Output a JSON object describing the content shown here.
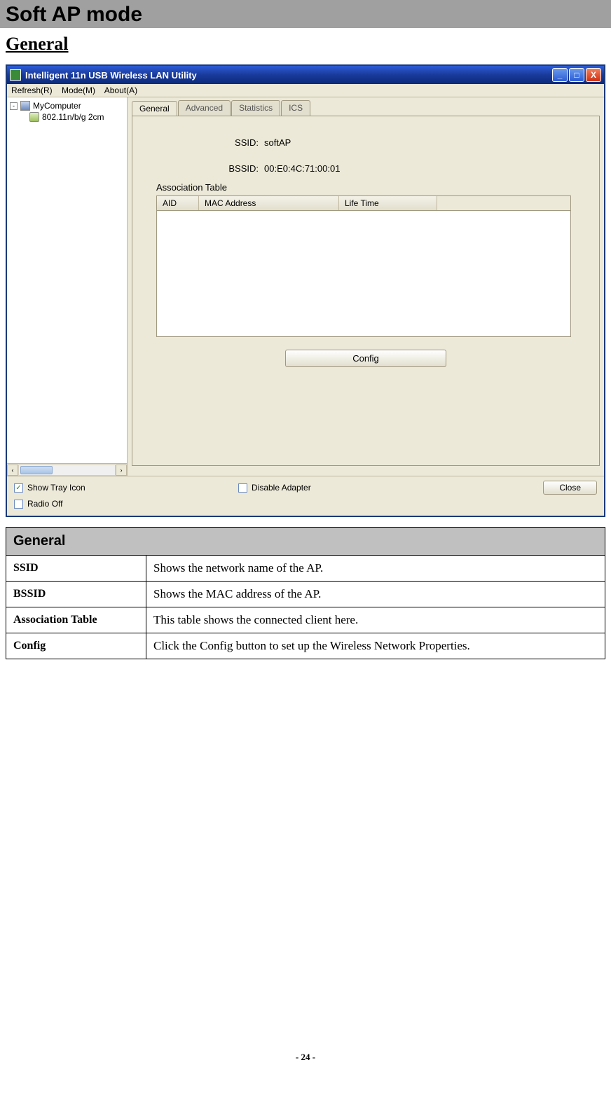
{
  "page": {
    "title": "Soft AP mode",
    "heading": "General",
    "footer": "- 24 -"
  },
  "window": {
    "title": "Intelligent 11n USB Wireless LAN Utility",
    "menu": {
      "refresh": "Refresh(R)",
      "mode": "Mode(M)",
      "about": "About(A)"
    },
    "minimize_glyph": "_",
    "maximize_glyph": "□",
    "close_glyph": "X"
  },
  "tree": {
    "root": "MyComputer",
    "adapter": "802.11n/b/g 2cm",
    "expand_glyph": "-",
    "scroll_left_glyph": "‹",
    "scroll_right_glyph": "›"
  },
  "tabs": {
    "general": "General",
    "advanced": "Advanced",
    "statistics": "Statistics",
    "ics": "ICS"
  },
  "general_panel": {
    "ssid_label": "SSID:",
    "ssid_value": "softAP",
    "bssid_label": "BSSID:",
    "bssid_value": "00:E0:4C:71:00:01",
    "assoc_label": "Association Table",
    "columns": {
      "aid": "AID",
      "mac": "MAC Address",
      "life": "Life Time"
    },
    "config_btn": "Config"
  },
  "bottom": {
    "show_tray": "Show Tray Icon",
    "show_tray_checked": "✓",
    "radio_off": "Radio Off",
    "disable_adapter": "Disable Adapter",
    "close_btn": "Close"
  },
  "desc": {
    "header": "General",
    "rows": [
      {
        "k": "SSID",
        "v": "Shows the network name of the AP."
      },
      {
        "k": "BSSID",
        "v": "Shows the MAC address of the AP."
      },
      {
        "k": "Association Table",
        "v": "This table shows the connected client here."
      },
      {
        "k": "Config",
        "v": "Click the Config button to set up the Wireless Network Properties."
      }
    ]
  }
}
